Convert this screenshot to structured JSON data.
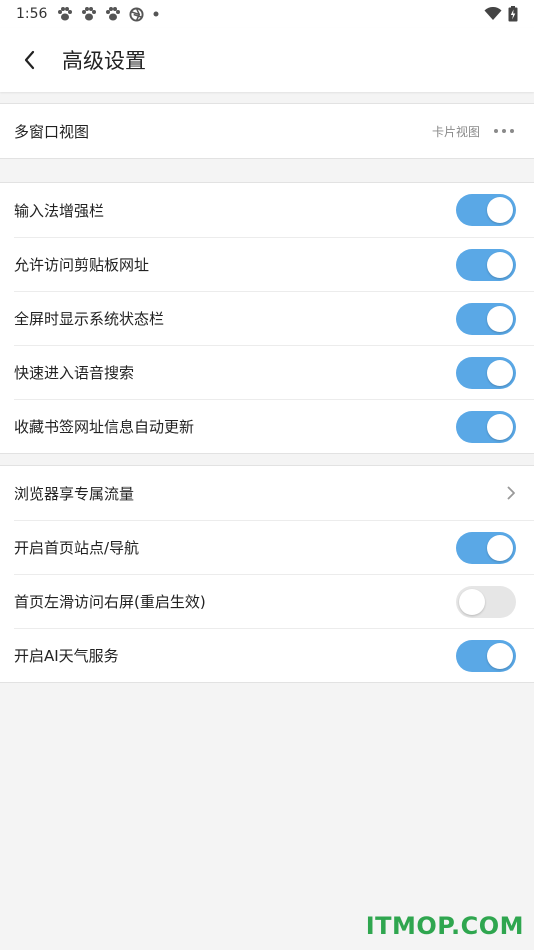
{
  "status_bar": {
    "time": "1:56",
    "notification_icons": [
      "paw-icon",
      "paw-icon",
      "paw-icon",
      "aperture-icon",
      "dot-icon"
    ],
    "right_icons": [
      "wifi-icon",
      "battery-charging-icon"
    ]
  },
  "header": {
    "back_icon": "back-arrow-icon",
    "title": "高级设置"
  },
  "section1": {
    "multiwindow": {
      "label": "多窗口视图",
      "value": "卡片视图",
      "icon": "more-dots-icon"
    }
  },
  "section2": {
    "items": [
      {
        "label": "输入法增强栏",
        "toggle": true
      },
      {
        "label": "允许访问剪贴板网址",
        "toggle": true
      },
      {
        "label": "全屏时显示系统状态栏",
        "toggle": true
      },
      {
        "label": "快速进入语音搜索",
        "toggle": true
      },
      {
        "label": "收藏书签网址信息自动更新",
        "toggle": true
      }
    ]
  },
  "section3": {
    "traffic": {
      "label": "浏览器享专属流量",
      "icon": "chevron-right-icon"
    },
    "items": [
      {
        "label": "开启首页站点/导航",
        "toggle": true
      },
      {
        "label": "首页左滑访问右屏(重启生效)",
        "toggle": false
      },
      {
        "label": "开启AI天气服务",
        "toggle": true
      }
    ]
  },
  "colors": {
    "accent": "#5aa8e6",
    "toggle_off": "#e6e6e6",
    "watermark": "#2fa64f"
  },
  "watermark": "ITMOP.COM"
}
